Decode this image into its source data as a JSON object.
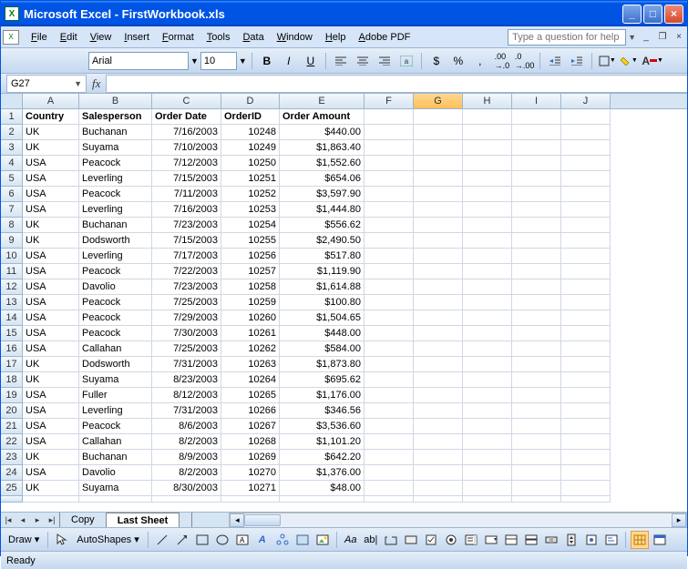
{
  "window": {
    "title": "Microsoft Excel - FirstWorkbook.xls"
  },
  "menu": {
    "items": [
      "File",
      "Edit",
      "View",
      "Insert",
      "Format",
      "Tools",
      "Data",
      "Window",
      "Help",
      "Adobe PDF"
    ],
    "help_placeholder": "Type a question for help"
  },
  "toolbar": {
    "font": "Arial",
    "size": "10"
  },
  "namebox": {
    "ref": "G27"
  },
  "columns": [
    "A",
    "B",
    "C",
    "D",
    "E",
    "F",
    "G",
    "H",
    "I",
    "J"
  ],
  "active_col": "G",
  "header_row": [
    "Country",
    "Salesperson",
    "Order Date",
    "OrderID",
    "Order Amount"
  ],
  "data": [
    [
      "UK",
      "Buchanan",
      "7/16/2003",
      "10248",
      "$440.00"
    ],
    [
      "UK",
      "Suyama",
      "7/10/2003",
      "10249",
      "$1,863.40"
    ],
    [
      "USA",
      "Peacock",
      "7/12/2003",
      "10250",
      "$1,552.60"
    ],
    [
      "USA",
      "Leverling",
      "7/15/2003",
      "10251",
      "$654.06"
    ],
    [
      "USA",
      "Peacock",
      "7/11/2003",
      "10252",
      "$3,597.90"
    ],
    [
      "USA",
      "Leverling",
      "7/16/2003",
      "10253",
      "$1,444.80"
    ],
    [
      "UK",
      "Buchanan",
      "7/23/2003",
      "10254",
      "$556.62"
    ],
    [
      "UK",
      "Dodsworth",
      "7/15/2003",
      "10255",
      "$2,490.50"
    ],
    [
      "USA",
      "Leverling",
      "7/17/2003",
      "10256",
      "$517.80"
    ],
    [
      "USA",
      "Peacock",
      "7/22/2003",
      "10257",
      "$1,119.90"
    ],
    [
      "USA",
      "Davolio",
      "7/23/2003",
      "10258",
      "$1,614.88"
    ],
    [
      "USA",
      "Peacock",
      "7/25/2003",
      "10259",
      "$100.80"
    ],
    [
      "USA",
      "Peacock",
      "7/29/2003",
      "10260",
      "$1,504.65"
    ],
    [
      "USA",
      "Peacock",
      "7/30/2003",
      "10261",
      "$448.00"
    ],
    [
      "USA",
      "Callahan",
      "7/25/2003",
      "10262",
      "$584.00"
    ],
    [
      "UK",
      "Dodsworth",
      "7/31/2003",
      "10263",
      "$1,873.80"
    ],
    [
      "UK",
      "Suyama",
      "8/23/2003",
      "10264",
      "$695.62"
    ],
    [
      "USA",
      "Fuller",
      "8/12/2003",
      "10265",
      "$1,176.00"
    ],
    [
      "USA",
      "Leverling",
      "7/31/2003",
      "10266",
      "$346.56"
    ],
    [
      "USA",
      "Peacock",
      "8/6/2003",
      "10267",
      "$3,536.60"
    ],
    [
      "USA",
      "Callahan",
      "8/2/2003",
      "10268",
      "$1,101.20"
    ],
    [
      "UK",
      "Buchanan",
      "8/9/2003",
      "10269",
      "$642.20"
    ],
    [
      "USA",
      "Davolio",
      "8/2/2003",
      "10270",
      "$1,376.00"
    ],
    [
      "UK",
      "Suyama",
      "8/30/2003",
      "10271",
      "$48.00"
    ]
  ],
  "sheet_tabs": [
    "Copy",
    "Last Sheet"
  ],
  "active_tab": 1,
  "draw": {
    "label": "Draw",
    "autoshapes": "AutoShapes"
  },
  "status": {
    "text": "Ready"
  }
}
